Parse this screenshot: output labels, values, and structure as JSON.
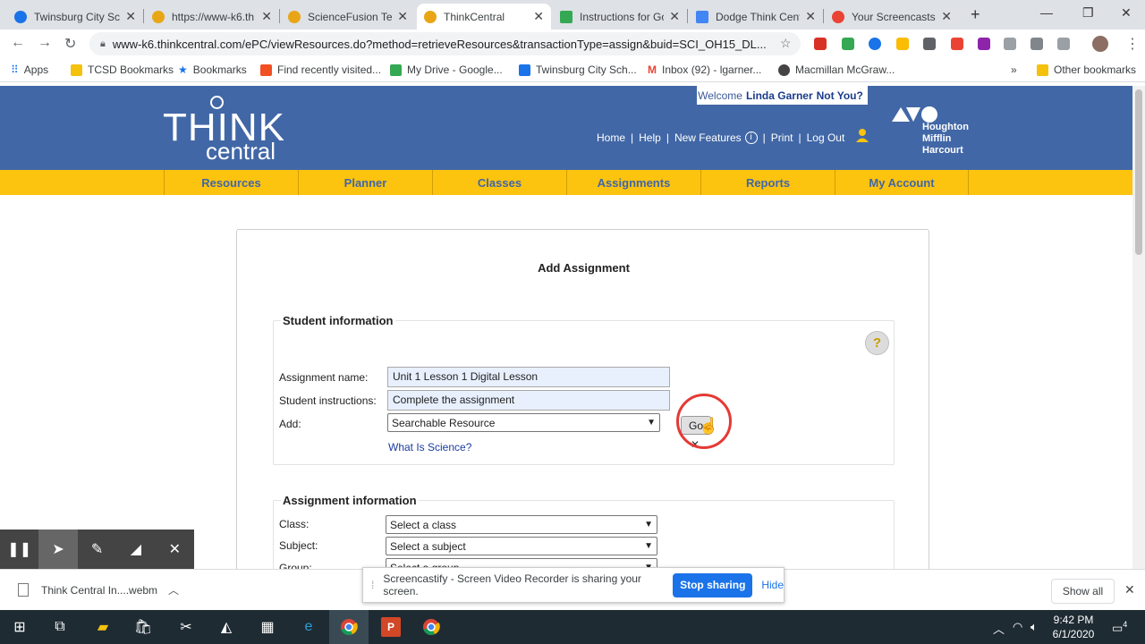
{
  "browser": {
    "tabs": [
      {
        "label": "Twinsburg City Sch",
        "color": "#1a73e8"
      },
      {
        "label": "https://www-k6.th",
        "color": "#e8a617"
      },
      {
        "label": "ScienceFusion Tea",
        "color": "#e8a617"
      },
      {
        "label": "ThinkCentral",
        "color": "#e8a617",
        "active": true
      },
      {
        "label": "Instructions for Go",
        "color": "#34a853"
      },
      {
        "label": "Dodge Think Centr",
        "color": "#4285f4"
      },
      {
        "label": "Your Screencasts",
        "color": "#ea4335"
      }
    ],
    "url": "www-k6.thinkcentral.com/ePC/viewResources.do?method=retrieveResources&transactionType=assign&buid=SCI_OH15_DL...",
    "bookmarks": [
      {
        "label": "Apps"
      },
      {
        "label": "TCSD Bookmarks"
      },
      {
        "label": "Bookmarks"
      },
      {
        "label": "Find recently visited..."
      },
      {
        "label": "My Drive - Google..."
      },
      {
        "label": "Twinsburg City Sch..."
      },
      {
        "label": "Inbox (92) - lgarner..."
      },
      {
        "label": "Macmillan McGraw..."
      },
      {
        "label": "Other bookmarks"
      }
    ],
    "overflow": "»"
  },
  "site": {
    "logo_think": "THINK",
    "logo_central": "central",
    "welcome_prefix": "Welcome",
    "welcome_user": "Linda Garner",
    "not_you": "Not You?",
    "links": {
      "home": "Home",
      "help": "Help",
      "new_features": "New Features",
      "print": "Print",
      "logout": "Log Out"
    },
    "publisher": [
      "Houghton",
      "Mifflin",
      "Harcourt"
    ],
    "nav": [
      "Resources",
      "Planner",
      "Classes",
      "Assignments",
      "Reports",
      "My Account"
    ]
  },
  "form": {
    "title": "Add Assignment",
    "student_section": "Student information",
    "assignment_name_label": "Assignment name:",
    "assignment_name_value": "Unit 1 Lesson 1 Digital Lesson",
    "instructions_label": "Student instructions:",
    "instructions_value": "Complete the assignment",
    "add_label": "Add:",
    "add_value": "Searchable Resource",
    "go_label": "Go",
    "help_glyph": "?",
    "resource_link": "What Is Science?",
    "assignment_section": "Assignment information",
    "class_label": "Class:",
    "class_value": "Select a class",
    "subject_label": "Subject:",
    "subject_value": "Select a subject",
    "group_label": "Group:",
    "group_value": "Select a group"
  },
  "download": {
    "file": "Think Central In....webm",
    "show_all": "Show all"
  },
  "share": {
    "text": "Screencastify - Screen Video Recorder is sharing your screen.",
    "stop": "Stop sharing",
    "hide": "Hide"
  },
  "taskbar": {
    "time": "9:42 PM",
    "date": "6/1/2020",
    "notifications": "4"
  }
}
